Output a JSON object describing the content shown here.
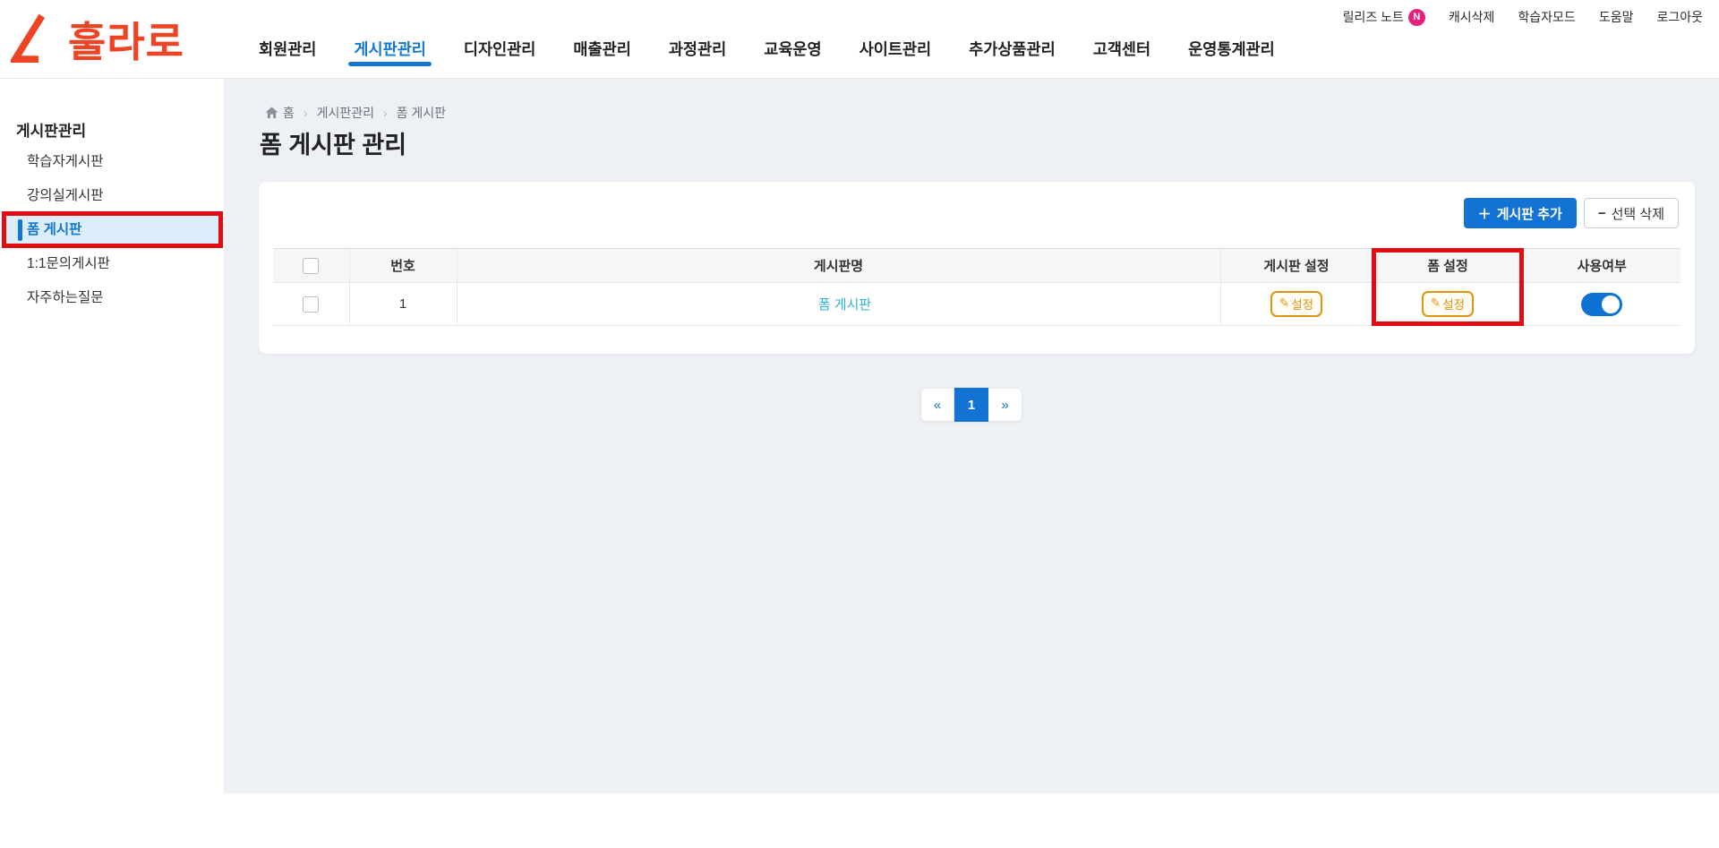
{
  "brand": {
    "name": "훌라로"
  },
  "topbar": {
    "utility": {
      "release_note": "릴리즈 노트",
      "release_badge": "N",
      "cache_clear": "캐시삭제",
      "learner_mode": "학습자모드",
      "help": "도움말",
      "logout": "로그아웃"
    },
    "nav": [
      {
        "label": "회원관리"
      },
      {
        "label": "게시판관리",
        "active": true
      },
      {
        "label": "디자인관리"
      },
      {
        "label": "매출관리"
      },
      {
        "label": "과정관리"
      },
      {
        "label": "교육운영"
      },
      {
        "label": "사이트관리"
      },
      {
        "label": "추가상품관리"
      },
      {
        "label": "고객센터"
      },
      {
        "label": "운영통계관리"
      }
    ]
  },
  "sidebar": {
    "title": "게시판관리",
    "items": [
      {
        "label": "학습자게시판"
      },
      {
        "label": "강의실게시판"
      },
      {
        "label": "폼 게시판",
        "active": true
      },
      {
        "label": "1:1문의게시판"
      },
      {
        "label": "자주하는질문"
      }
    ]
  },
  "breadcrumb": {
    "home": "홈",
    "level1": "게시판관리",
    "level2": "폼 게시판"
  },
  "page": {
    "title": "폼 게시판 관리"
  },
  "toolbar": {
    "add_button": "게시판 추가",
    "delete_button": "선택 삭제"
  },
  "table": {
    "headers": {
      "no": "번호",
      "name": "게시판명",
      "board_setting": "게시판 설정",
      "form_setting": "폼 설정",
      "in_use": "사용여부"
    },
    "rows": [
      {
        "no": "1",
        "name": "폼 게시판",
        "board_setting_label": "설정",
        "form_setting_label": "설정",
        "in_use": "on"
      }
    ]
  },
  "pagination": {
    "prev": "«",
    "page": "1",
    "next": "»"
  },
  "icons": {
    "plus": "＋",
    "minus": "−",
    "pencil": "✎",
    "breadcrumb_separator": "›"
  },
  "colors": {
    "accent_blue": "#1273d4",
    "nav_blue": "#1478d2",
    "link_cyan": "#2eb4d8",
    "badge_orange": "#e0940e",
    "logo_red": "#ee4423",
    "note_pink": "#e5217e",
    "annotation_red": "#e20d12",
    "content_bg": "#edf0f5"
  }
}
